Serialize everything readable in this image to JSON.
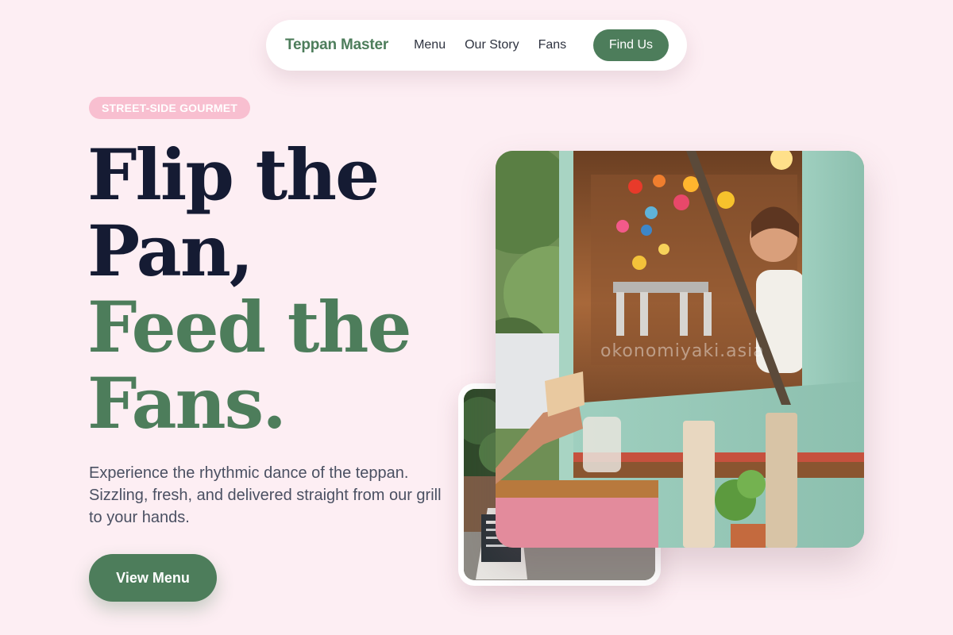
{
  "nav": {
    "brand": "Teppan Master",
    "links": [
      "Menu",
      "Our Story",
      "Fans"
    ],
    "cta": "Find Us"
  },
  "hero": {
    "badge": "STREET-SIDE GOURMET",
    "headline": {
      "line1": "Flip the",
      "line2": "Pan,",
      "line3": "Feed the",
      "line4": "Fans."
    },
    "description": "Experience the rhythmic dance of the teppan. Sizzling, fresh, and delivered straight from our grill to your hands.",
    "cta": "View Menu"
  },
  "photos": {
    "main_watermark": "okonomiyaki.asia"
  },
  "colors": {
    "background": "#fdeef3",
    "accent_green": "#4d7d5b",
    "headline_dark": "#151b33",
    "badge_pink": "#f8bfd0"
  }
}
